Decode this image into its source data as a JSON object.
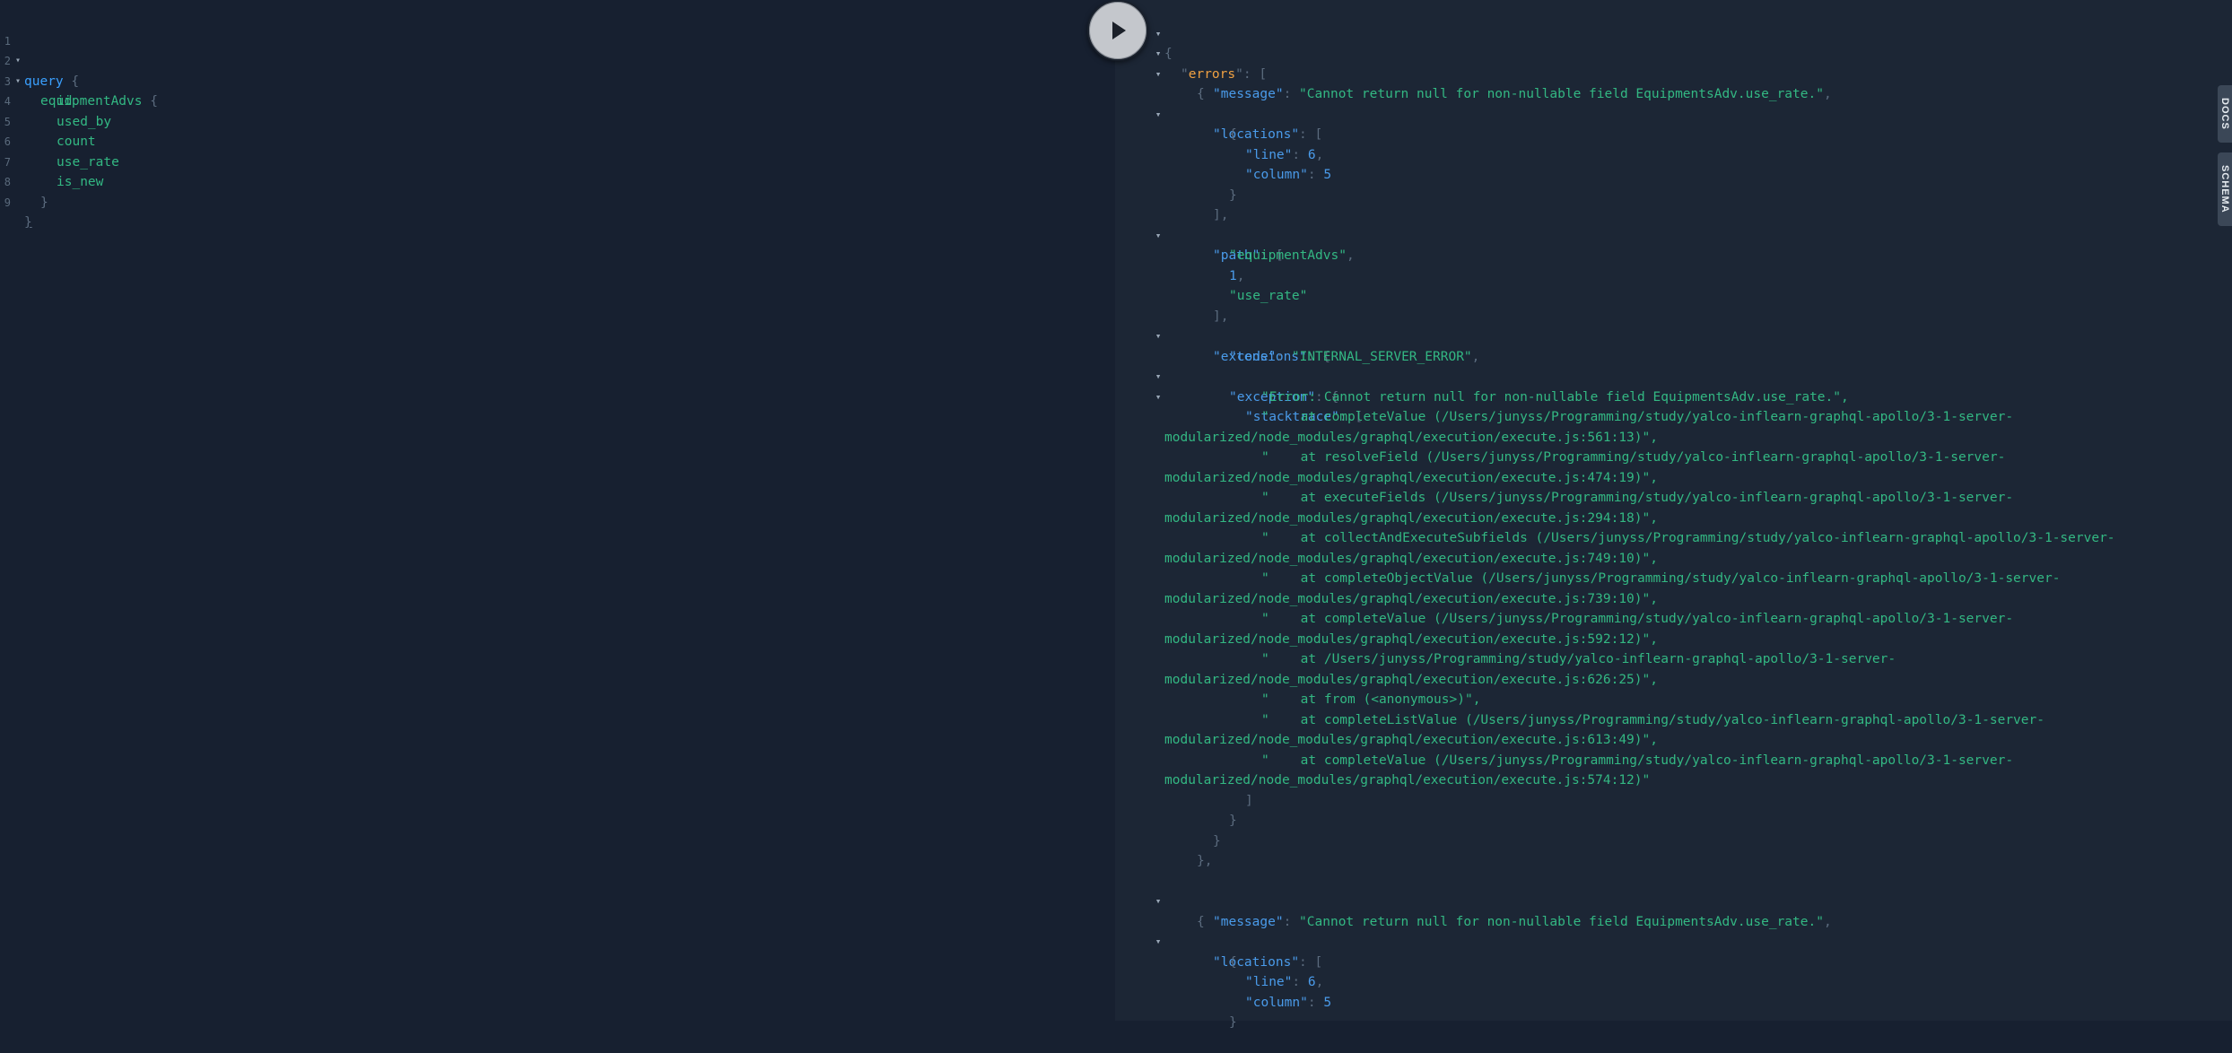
{
  "editor": {
    "line_numbers": [
      "1",
      "2",
      "3",
      "4",
      "5",
      "6",
      "7",
      "8",
      "9"
    ],
    "query_keyword": "query",
    "root_field": "equipmentAdvs",
    "fields": [
      "id",
      "used_by",
      "count",
      "use_rate",
      "is_new"
    ]
  },
  "toolbar": {
    "run_icon": "play-icon"
  },
  "side_tabs": {
    "docs": "DOCS",
    "schema": "SCHEMA"
  },
  "result": {
    "keys": {
      "errors": "errors",
      "message": "message",
      "locations": "locations",
      "line": "line",
      "column": "column",
      "path": "path",
      "extensions": "extensions",
      "code": "code",
      "exception": "exception",
      "stacktrace": "stacktrace"
    },
    "message_text": "Cannot return null for non-nullable field EquipmentsAdv.use_rate.",
    "line_value": "6",
    "column_value": "5",
    "path_values": [
      "equipmentAdvs",
      "1",
      "use_rate"
    ],
    "code_value": "INTERNAL_SERVER_ERROR",
    "stack_lines": [
      "\"Error: Cannot return null for non-nullable field EquipmentsAdv.use_rate.\",",
      "\"    at completeValue (/Users/junyss/Programming/study/yalco-inflearn-graphql-apollo/3-1-server-",
      "modularized/node_modules/graphql/execution/execute.js:561:13)\",",
      "\"    at resolveField (/Users/junyss/Programming/study/yalco-inflearn-graphql-apollo/3-1-server-",
      "modularized/node_modules/graphql/execution/execute.js:474:19)\",",
      "\"    at executeFields (/Users/junyss/Programming/study/yalco-inflearn-graphql-apollo/3-1-server-",
      "modularized/node_modules/graphql/execution/execute.js:294:18)\",",
      "\"    at collectAndExecuteSubfields (/Users/junyss/Programming/study/yalco-inflearn-graphql-apollo/3-1-server-",
      "modularized/node_modules/graphql/execution/execute.js:749:10)\",",
      "\"    at completeObjectValue (/Users/junyss/Programming/study/yalco-inflearn-graphql-apollo/3-1-server-",
      "modularized/node_modules/graphql/execution/execute.js:739:10)\",",
      "\"    at completeValue (/Users/junyss/Programming/study/yalco-inflearn-graphql-apollo/3-1-server-",
      "modularized/node_modules/graphql/execution/execute.js:592:12)\",",
      "\"    at /Users/junyss/Programming/study/yalco-inflearn-graphql-apollo/3-1-server-",
      "modularized/node_modules/graphql/execution/execute.js:626:25)\",",
      "\"    at from (<anonymous>)\",",
      "\"    at completeListValue (/Users/junyss/Programming/study/yalco-inflearn-graphql-apollo/3-1-server-",
      "modularized/node_modules/graphql/execution/execute.js:613:49)\",",
      "\"    at completeValue (/Users/junyss/Programming/study/yalco-inflearn-graphql-apollo/3-1-server-",
      "modularized/node_modules/graphql/execution/execute.js:574:12)\""
    ]
  }
}
